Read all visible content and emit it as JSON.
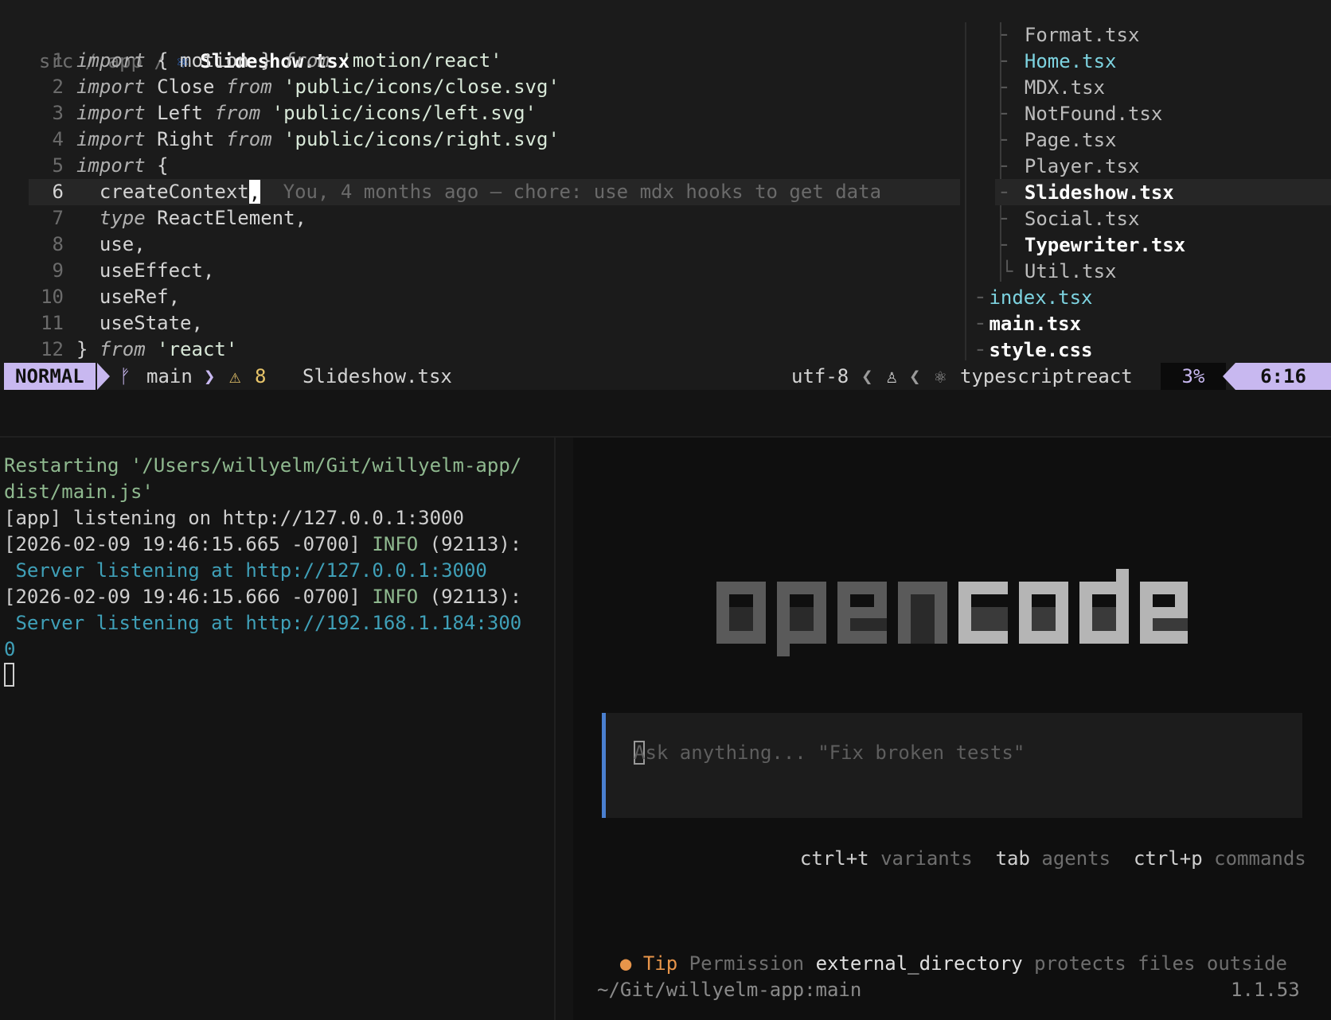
{
  "editor": {
    "breadcrumb": {
      "dir1": "src",
      "dir2": "app",
      "sep": "/",
      "file": "Slideshow.tsx"
    },
    "lines": [
      {
        "n": "1",
        "parts": [
          [
            "kw",
            "import"
          ],
          [
            "id",
            " { motion } "
          ],
          [
            "kw",
            "from"
          ],
          [
            "str",
            " 'motion/react'"
          ]
        ]
      },
      {
        "n": "2",
        "parts": [
          [
            "kw",
            "import"
          ],
          [
            "id",
            " Close "
          ],
          [
            "kw",
            "from"
          ],
          [
            "str",
            " 'public/icons/close.svg'"
          ]
        ]
      },
      {
        "n": "3",
        "parts": [
          [
            "kw",
            "import"
          ],
          [
            "id",
            " Left "
          ],
          [
            "kw",
            "from"
          ],
          [
            "str",
            " 'public/icons/left.svg'"
          ]
        ]
      },
      {
        "n": "4",
        "parts": [
          [
            "kw",
            "import"
          ],
          [
            "id",
            " Right "
          ],
          [
            "kw",
            "from"
          ],
          [
            "str",
            " 'public/icons/right.svg'"
          ]
        ]
      },
      {
        "n": "5",
        "parts": [
          [
            "kw",
            "import"
          ],
          [
            "id",
            " {"
          ]
        ]
      },
      {
        "n": "6",
        "parts": [
          [
            "id",
            "  createContext"
          ]
        ]
      },
      {
        "n": "7",
        "parts": [
          [
            "id",
            "  "
          ],
          [
            "kw",
            "type"
          ],
          [
            "id",
            " ReactElement,"
          ]
        ]
      },
      {
        "n": "8",
        "parts": [
          [
            "id",
            "  use,"
          ]
        ]
      },
      {
        "n": "9",
        "parts": [
          [
            "id",
            "  useEffect,"
          ]
        ]
      },
      {
        "n": "10",
        "parts": [
          [
            "id",
            "  useRef,"
          ]
        ]
      },
      {
        "n": "11",
        "parts": [
          [
            "id",
            "  useState,"
          ]
        ]
      },
      {
        "n": "12",
        "parts": [
          [
            "id",
            "} "
          ],
          [
            "kw",
            "from"
          ],
          [
            "str",
            " 'react'"
          ]
        ]
      }
    ],
    "cursor_char": ",",
    "blame": "You, 4 months ago – chore: use mdx hooks to get data"
  },
  "tree": [
    {
      "label": "Format.tsx",
      "style": "",
      "indent": 2
    },
    {
      "label": "Home.tsx",
      "style": "cyan",
      "indent": 2
    },
    {
      "label": "MDX.tsx",
      "style": "",
      "indent": 2
    },
    {
      "label": "NotFound.tsx",
      "style": "",
      "indent": 2
    },
    {
      "label": "Page.tsx",
      "style": "",
      "indent": 2
    },
    {
      "label": "Player.tsx",
      "style": "",
      "indent": 2
    },
    {
      "label": "Slideshow.tsx",
      "style": "bold",
      "indent": 2
    },
    {
      "label": "Social.tsx",
      "style": "",
      "indent": 2
    },
    {
      "label": "Typewriter.tsx",
      "style": "bold",
      "indent": 2
    },
    {
      "label": "Util.tsx",
      "style": "",
      "indent": 2
    },
    {
      "label": "index.tsx",
      "style": "cyan",
      "indent": 1
    },
    {
      "label": "main.tsx",
      "style": "bold",
      "indent": 1
    },
    {
      "label": "style.css",
      "style": "bold",
      "indent": 1
    }
  ],
  "status": {
    "mode": "NORMAL",
    "branch": "main",
    "warnings": "8",
    "file": "Slideshow.tsx",
    "encoding": "utf-8",
    "filetype": "typescriptreact",
    "percent": "3%",
    "position": "6:16"
  },
  "terminal": {
    "lines": [
      {
        "cls": "t-green",
        "text": "Restarting '/Users/willyelm/Git/willyelm-app/"
      },
      {
        "cls": "t-green",
        "text": "dist/main.js'"
      },
      {
        "cls": "t-white",
        "text": "[app] listening on http://127.0.0.1:3000"
      },
      {
        "cls": "t-white",
        "text": "[2026-02-09 19:46:15.665 -0700] ",
        "extra": "INFO",
        "rest": " (92113):"
      },
      {
        "cls": "t-blue",
        "text": " Server listening at http://127.0.0.1:3000"
      },
      {
        "cls": "t-white",
        "text": "[2026-02-09 19:46:15.666 -0700] ",
        "extra": "INFO",
        "rest": " (92113):"
      },
      {
        "cls": "t-blue",
        "text": " Server listening at http://192.168.1.184:300"
      },
      {
        "cls": "t-blue",
        "text": "0"
      }
    ]
  },
  "opencode": {
    "logo_left": "open",
    "logo_right": "code",
    "prompt_placeholder": "Ask anything... \"Fix broken tests\"",
    "hints": [
      {
        "key": "ctrl+t",
        "label": "variants"
      },
      {
        "key": "tab",
        "label": "agents"
      },
      {
        "key": "ctrl+p",
        "label": "commands"
      }
    ],
    "tip": {
      "label": "Tip",
      "text1": "Permission",
      "highlight": "external_directory",
      "text2": "protects files outside"
    },
    "path": "~/Git/willyelm-app:main",
    "version": "1.1.53"
  },
  "colors": {
    "mode_bg": "#c8b8f0",
    "accent_blue": "#4a7fd0",
    "tip_orange": "#e8954a",
    "term_url_blue": "#3fa0b8"
  },
  "icons": [
    "react-icon",
    "git-branch-icon",
    "warning-icon",
    "linux-penguin-icon",
    "chevron-left-icon"
  ]
}
